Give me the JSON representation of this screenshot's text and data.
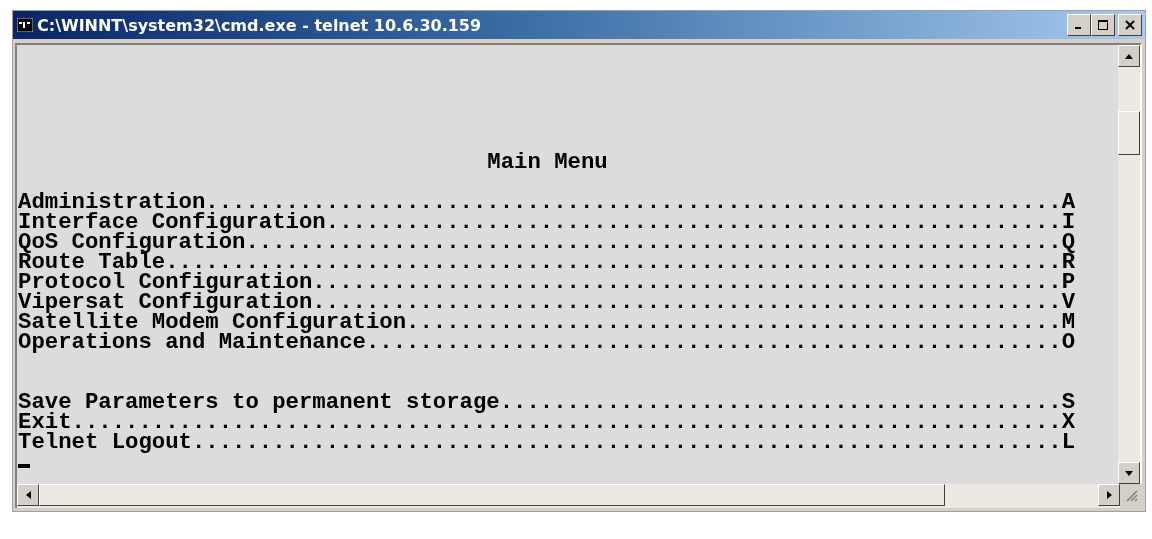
{
  "window": {
    "title": "C:\\WINNT\\system32\\cmd.exe - telnet 10.6.30.159"
  },
  "terminal": {
    "heading": "Main Menu",
    "groups": [
      {
        "lines": [
          "Administration................................................................A",
          "Interface Configuration.......................................................I",
          "QoS Configuration.............................................................Q",
          "Route Table...................................................................R",
          "Protocol Configuration........................................................P",
          "Vipersat Configuration........................................................V",
          "Satellite Modem Configuration.................................................M",
          "Operations and Maintenance....................................................O"
        ]
      },
      {
        "lines": [
          "Save Parameters to permanent storage..........................................S",
          "Exit..........................................................................X",
          "Telnet Logout.................................................................L"
        ]
      }
    ]
  }
}
